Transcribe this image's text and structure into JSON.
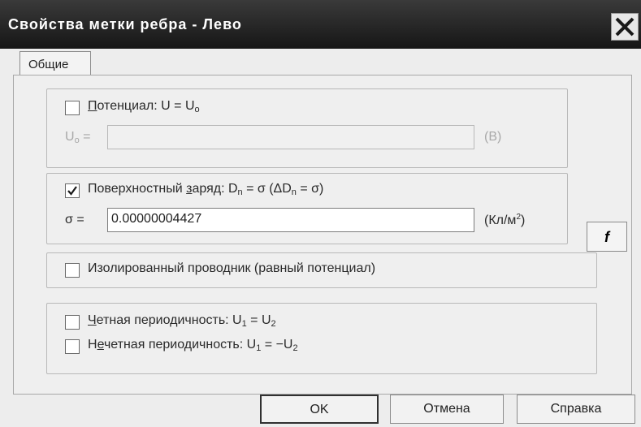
{
  "window": {
    "title": "Свойства метки ребра - Лево"
  },
  "tabs": [
    {
      "label": "Общие",
      "selected": true
    }
  ],
  "potential": {
    "checkbox_checked": false,
    "label_accel": "П",
    "label_rest": "отенциал: U = U",
    "label_sub": "о",
    "field_label_main": "U",
    "field_label_sub": "о",
    "field_label_suffix": " =",
    "field_value": "",
    "unit": "(В)"
  },
  "f_button": {
    "label": "f"
  },
  "surface_charge": {
    "checkbox_checked": true,
    "label_pre": "Поверхностный ",
    "label_accel": "з",
    "label_mid": "аряд: D",
    "label_sub_n": "n",
    "label_mid2": " = σ (ΔD",
    "label_sub_n2": "n",
    "label_end": " = σ)",
    "field_label": "σ =",
    "field_value": "0.00000004427",
    "unit_main": "(Кл/м",
    "unit_sup": "2",
    "unit_end": ")"
  },
  "isolated_conductor": {
    "checkbox_checked": false,
    "label": "Изолированный проводник (равный потенциал)"
  },
  "periodicity": {
    "even": {
      "checkbox_checked": false,
      "label_accel": "Ч",
      "label_rest": "етная периодичность: U",
      "sub1": "1",
      "mid": " = U",
      "sub2": "2"
    },
    "odd": {
      "checkbox_checked": false,
      "label_pre": "Н",
      "label_accel": "е",
      "label_rest": "четная периодичность: U",
      "sub1": "1",
      "mid": " = −U",
      "sub2": "2"
    }
  },
  "buttons": {
    "ok": "OK",
    "cancel": "Отмена",
    "help": "Справка"
  }
}
